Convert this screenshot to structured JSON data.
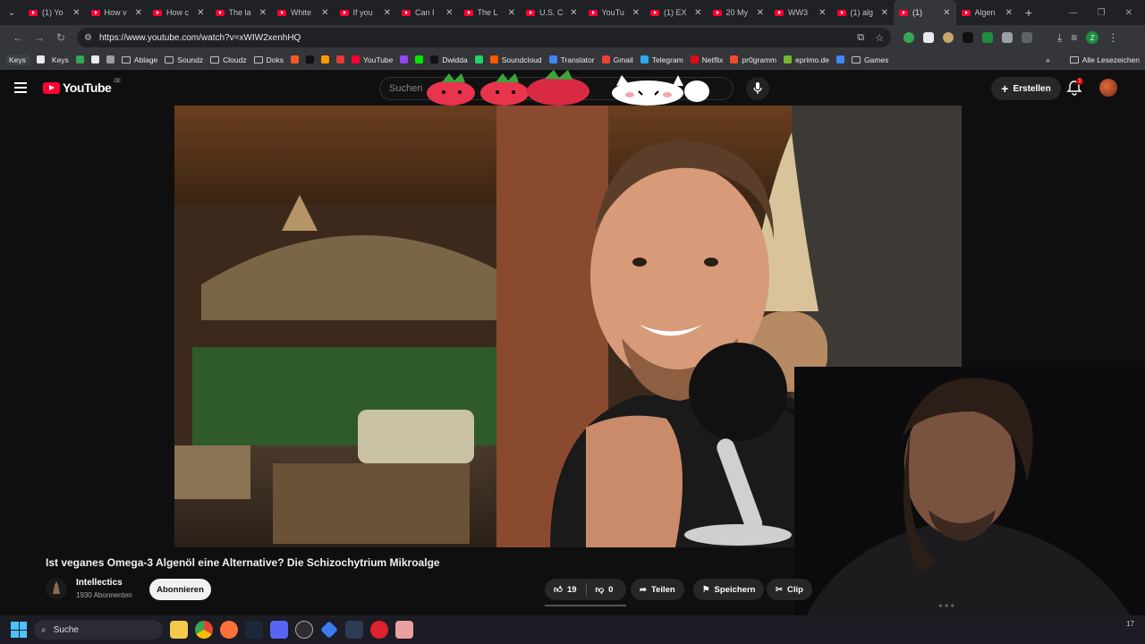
{
  "browser": {
    "tabs": [
      {
        "title": "(1) Yo"
      },
      {
        "title": "How v"
      },
      {
        "title": "How c"
      },
      {
        "title": "The la"
      },
      {
        "title": "White"
      },
      {
        "title": "If you"
      },
      {
        "title": "Can I"
      },
      {
        "title": "The L"
      },
      {
        "title": "U.S. C"
      },
      {
        "title": "YouTu"
      },
      {
        "title": "(1) EX"
      },
      {
        "title": "20 My"
      },
      {
        "title": "WW3"
      },
      {
        "title": "(1) alg"
      },
      {
        "title": "(1)"
      },
      {
        "title": "Algen"
      }
    ],
    "url": "https://www.youtube.com/watch?v=xWIW2xenhHQ",
    "profile_letter": "Z"
  },
  "bookmarks": [
    {
      "label": "Keys",
      "type": "chip"
    },
    {
      "label": "",
      "type": "icon"
    },
    {
      "label": "Keys",
      "type": "text"
    },
    {
      "label": "",
      "type": "icon"
    },
    {
      "label": "",
      "type": "icon"
    },
    {
      "label": "",
      "type": "icon"
    },
    {
      "label": "Ablage",
      "type": "folder"
    },
    {
      "label": "Soundz",
      "type": "folder"
    },
    {
      "label": "Cloudz",
      "type": "folder"
    },
    {
      "label": "Doks",
      "type": "folder"
    },
    {
      "label": "",
      "type": "icon"
    },
    {
      "label": "",
      "type": "icon"
    },
    {
      "label": "",
      "type": "icon"
    },
    {
      "label": "",
      "type": "icon"
    },
    {
      "label": "YouTube",
      "type": "link"
    },
    {
      "label": "",
      "type": "icon"
    },
    {
      "label": "",
      "type": "icon"
    },
    {
      "label": "Dwidda",
      "type": "link"
    },
    {
      "label": "",
      "type": "icon"
    },
    {
      "label": "Soundcloud",
      "type": "link"
    },
    {
      "label": "Translator",
      "type": "link"
    },
    {
      "label": "Gmail",
      "type": "link"
    },
    {
      "label": "Telegram",
      "type": "link"
    },
    {
      "label": "Netflix",
      "type": "link"
    },
    {
      "label": "pr0gramm",
      "type": "link"
    },
    {
      "label": "eprimo.de",
      "type": "link"
    },
    {
      "label": "",
      "type": "icon"
    },
    {
      "label": "Games",
      "type": "folder"
    }
  ],
  "bookmarks_more": "»",
  "bookmarks_all": "Alle Lesezeichen",
  "youtube": {
    "logo_text": "YouTube",
    "region": "DE",
    "search_placeholder": "Suchen",
    "create_label": "Erstellen",
    "notification_count": "1"
  },
  "video": {
    "title": "Ist veganes Omega-3 Algenöl eine Alternative? Die Schizochytrium Mikroalge",
    "channel": "Intellectics",
    "subscribers": "1930 Abonnenten",
    "subscribe_label": "Abonnieren",
    "likes": "19",
    "dislikes": "0",
    "share_label": "Teilen",
    "save_label": "Speichern",
    "clip_label": "Clip"
  },
  "taskbar": {
    "search_label": "Suche",
    "tray_text": "17"
  }
}
